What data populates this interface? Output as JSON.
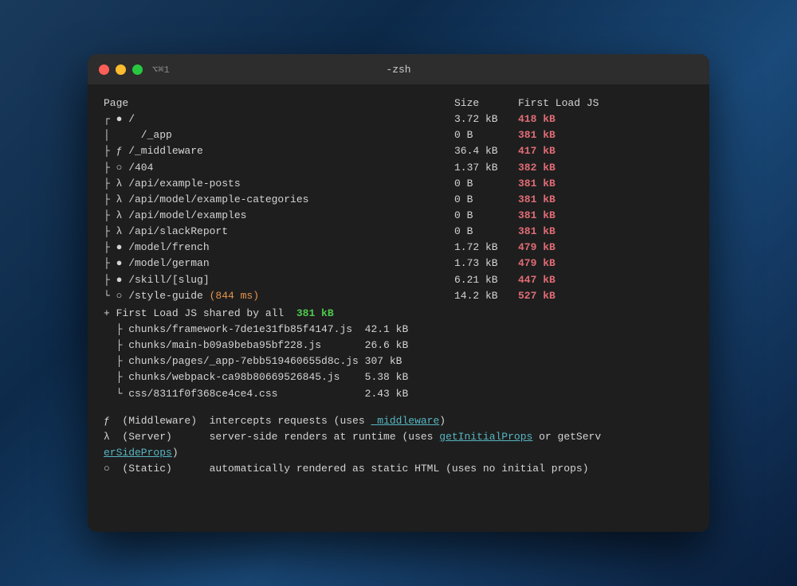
{
  "window": {
    "title": "-zsh",
    "controls_label": "⌥⌘1"
  },
  "terminal": {
    "header_row": {
      "page": "Page",
      "size": "Size",
      "first_load": "First Load JS"
    },
    "rows": [
      {
        "prefix": "┌ ● ",
        "page": "/",
        "size": "3.72 kB",
        "first_load": "418 kB",
        "first_load_color": "red"
      },
      {
        "prefix": "│   ",
        "page": "/_app",
        "size": "0 B",
        "first_load": "381 kB",
        "first_load_color": "red"
      },
      {
        "prefix": "├ ƒ ",
        "page": "/_middleware",
        "size": "36.4 kB",
        "first_load": "417 kB",
        "first_load_color": "red"
      },
      {
        "prefix": "├ ○ ",
        "page": "/404",
        "size": "1.37 kB",
        "first_load": "382 kB",
        "first_load_color": "red"
      },
      {
        "prefix": "├ λ ",
        "page": "/api/example-posts",
        "size": "0 B",
        "first_load": "381 kB",
        "first_load_color": "red"
      },
      {
        "prefix": "├ λ ",
        "page": "/api/model/example-categories",
        "size": "0 B",
        "first_load": "381 kB",
        "first_load_color": "red"
      },
      {
        "prefix": "├ λ ",
        "page": "/api/model/examples",
        "size": "0 B",
        "first_load": "381 kB",
        "first_load_color": "red"
      },
      {
        "prefix": "├ λ ",
        "page": "/api/slackReport",
        "size": "0 B",
        "first_load": "381 kB",
        "first_load_color": "red"
      },
      {
        "prefix": "├ ● ",
        "page": "/model/french",
        "size": "1.72 kB",
        "first_load": "479 kB",
        "first_load_color": "red"
      },
      {
        "prefix": "├ ● ",
        "page": "/model/german",
        "size": "1.73 kB",
        "first_load": "479 kB",
        "first_load_color": "red"
      },
      {
        "prefix": "├ ● ",
        "page": "/skill/[slug]",
        "size": "6.21 kB",
        "first_load": "447 kB",
        "first_load_color": "red"
      },
      {
        "prefix": "└ ○ ",
        "page": "/style-guide (844 ms)",
        "size": "14.2 kB",
        "first_load": "527 kB",
        "first_load_color": "red"
      }
    ],
    "shared_row": {
      "prefix": "+ ",
      "label": "First Load JS shared by all",
      "size": "381 kB",
      "size_color": "green"
    },
    "chunks": [
      {
        "name": "chunks/framework-7de1e31fb85f4147.js",
        "size": "42.1 kB"
      },
      {
        "name": "chunks/main-b09a9beba95bf228.js",
        "size": "26.6 kB"
      },
      {
        "name": "chunks/pages/_app-7ebb519460655d8c.js",
        "size": "307 kB"
      },
      {
        "name": "chunks/webpack-ca98b80669526845.js",
        "size": "5.38 kB"
      },
      {
        "name": "css/8311f0f368ce4ce4.css",
        "size": "2.43 kB"
      }
    ],
    "legend": [
      {
        "symbol": "ƒ",
        "type": "(Middleware)",
        "desc1": "intercepts requests (uses ",
        "highlight": "_middleware",
        "desc2": ")"
      },
      {
        "symbol": "λ",
        "type": "(Server)",
        "desc1": "server-side renders at runtime (uses ",
        "highlight": "getInitialProps",
        "desc2": " or getServ"
      },
      {
        "continuation": "erSideProps",
        "desc2": ")"
      },
      {
        "symbol": "○",
        "type": "(Static)",
        "desc1": "automatically rendered as static HTML (uses no initial props)"
      }
    ]
  }
}
